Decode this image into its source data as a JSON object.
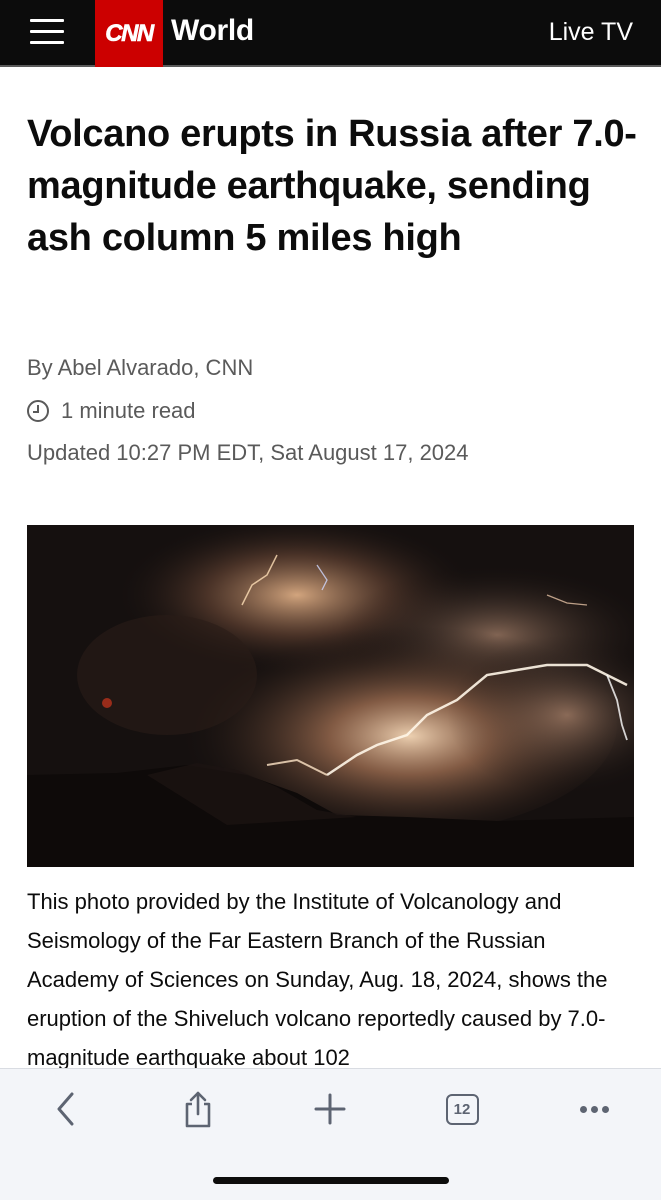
{
  "header": {
    "logo_text": "CNN",
    "section": "World",
    "live_tv": "Live TV",
    "brand_color": "#cc0000"
  },
  "article": {
    "headline": "Volcano erupts in Russia after 7.0-magnitude earthquake, sending ash column 5 miles high",
    "byline": "By Abel Alvarado, CNN",
    "read_time": "1 minute read",
    "updated": "Updated 10:27 PM EDT, Sat August 17, 2024",
    "caption": "This photo provided by the Institute of Volcanology and Seismology of the Far Eastern Branch of the Russian Academy of Sciences on Sunday, Aug. 18, 2024, shows the eruption of the Shiveluch volcano reportedly caused by 7.0-magnitude earthquake about 102"
  },
  "toolbar": {
    "tab_count": "12",
    "icons": [
      "back-icon",
      "share-icon",
      "plus-icon",
      "tabs-icon",
      "more-icon"
    ]
  }
}
